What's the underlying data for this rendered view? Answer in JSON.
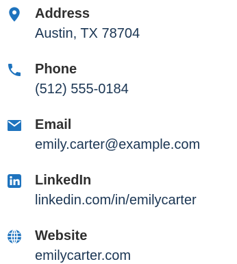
{
  "theme": {
    "accent": "#1e73be",
    "label_color": "#2f2f2f",
    "value_color": "#1a3553",
    "background": "#ffffff"
  },
  "contacts": [
    {
      "icon": "map-pin-icon",
      "label": "Address",
      "value": "Austin, TX 78704"
    },
    {
      "icon": "phone-icon",
      "label": "Phone",
      "value": "(512) 555-0184"
    },
    {
      "icon": "envelope-icon",
      "label": "Email",
      "value": "emily.carter@example.com"
    },
    {
      "icon": "linkedin-icon",
      "label": "LinkedIn",
      "value": "linkedin.com/in/emilycarter"
    },
    {
      "icon": "globe-icon",
      "label": "Website",
      "value": "emilycarter.com"
    }
  ]
}
